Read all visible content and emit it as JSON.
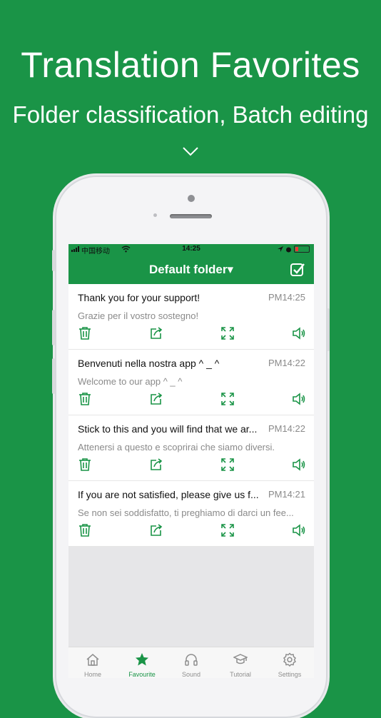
{
  "promo": {
    "title": "Translation Favorites",
    "subtitle": "Folder classification, Batch editing"
  },
  "status_bar": {
    "carrier": "中国移动",
    "time": "14:25"
  },
  "nav": {
    "folder_title": "Default folder",
    "dropdown_caret": "▾"
  },
  "favorites": [
    {
      "source": "Thank you for your support!",
      "time": "PM14:25",
      "translation": "Grazie per il vostro sostegno!"
    },
    {
      "source": "Benvenuti nella nostra app ^ _ ^",
      "time": "PM14:22",
      "translation": "Welcome to our app ^ _ ^"
    },
    {
      "source": "Stick to this and you will find that we ar...",
      "time": "PM14:22",
      "translation": "Attenersi a questo e scoprirai che siamo diversi."
    },
    {
      "source": "If you are not satisfied, please give us f...",
      "time": "PM14:21",
      "translation": "Se non sei soddisfatto, ti preghiamo di darci un fee..."
    }
  ],
  "item_actions": [
    "trash-icon",
    "share-icon",
    "fullscreen-icon",
    "speaker-icon"
  ],
  "tabbar": [
    {
      "label": "Home",
      "icon": "home-icon",
      "active": false
    },
    {
      "label": "Favourite",
      "icon": "star-icon",
      "active": true
    },
    {
      "label": "Sound",
      "icon": "headphones-icon",
      "active": false
    },
    {
      "label": "Tutorial",
      "icon": "graduation-cap-icon",
      "active": false
    },
    {
      "label": "Settings",
      "icon": "gear-icon",
      "active": false
    }
  ],
  "colors": {
    "brand_green": "#1a9447",
    "inactive_gray": "#8e8e8e",
    "text_dark": "#111111",
    "text_muted": "#8a8a8a"
  }
}
